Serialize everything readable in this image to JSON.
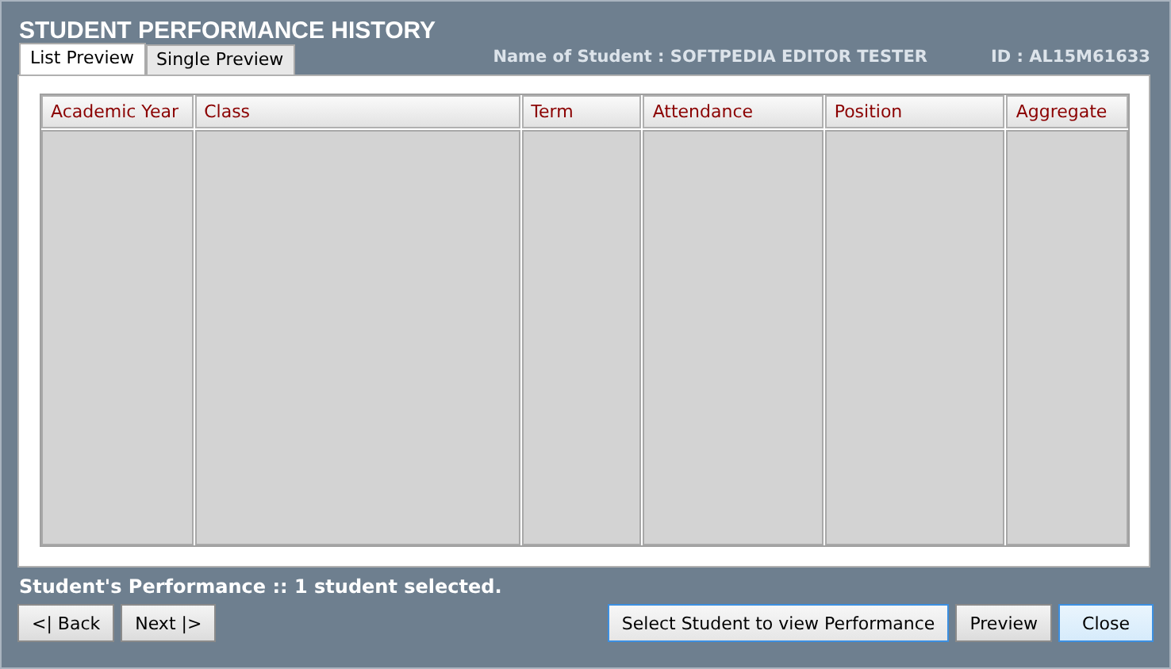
{
  "window": {
    "title": "STUDENT PERFORMANCE HISTORY"
  },
  "tabs": [
    {
      "label": "List Preview",
      "selected": true
    },
    {
      "label": "Single Preview",
      "selected": false
    }
  ],
  "student": {
    "name": "Name of Student : SOFTPEDIA EDITOR TESTER",
    "id": "ID : AL15M61633"
  },
  "table": {
    "columns": [
      "Academic Year",
      "Class",
      "Term",
      "Attendance",
      "Position",
      "Aggregate"
    ]
  },
  "status": "Student's Performance :: 1 student selected.",
  "nav_buttons": [
    {
      "label": "<| Back",
      "kind": "normal"
    },
    {
      "label": "Next |>",
      "kind": "normal"
    }
  ],
  "action_buttons": [
    {
      "label": "Select Student to view Performance",
      "kind": "focused"
    },
    {
      "label": "Preview",
      "kind": "normal"
    },
    {
      "label": "Close",
      "kind": "default"
    }
  ]
}
